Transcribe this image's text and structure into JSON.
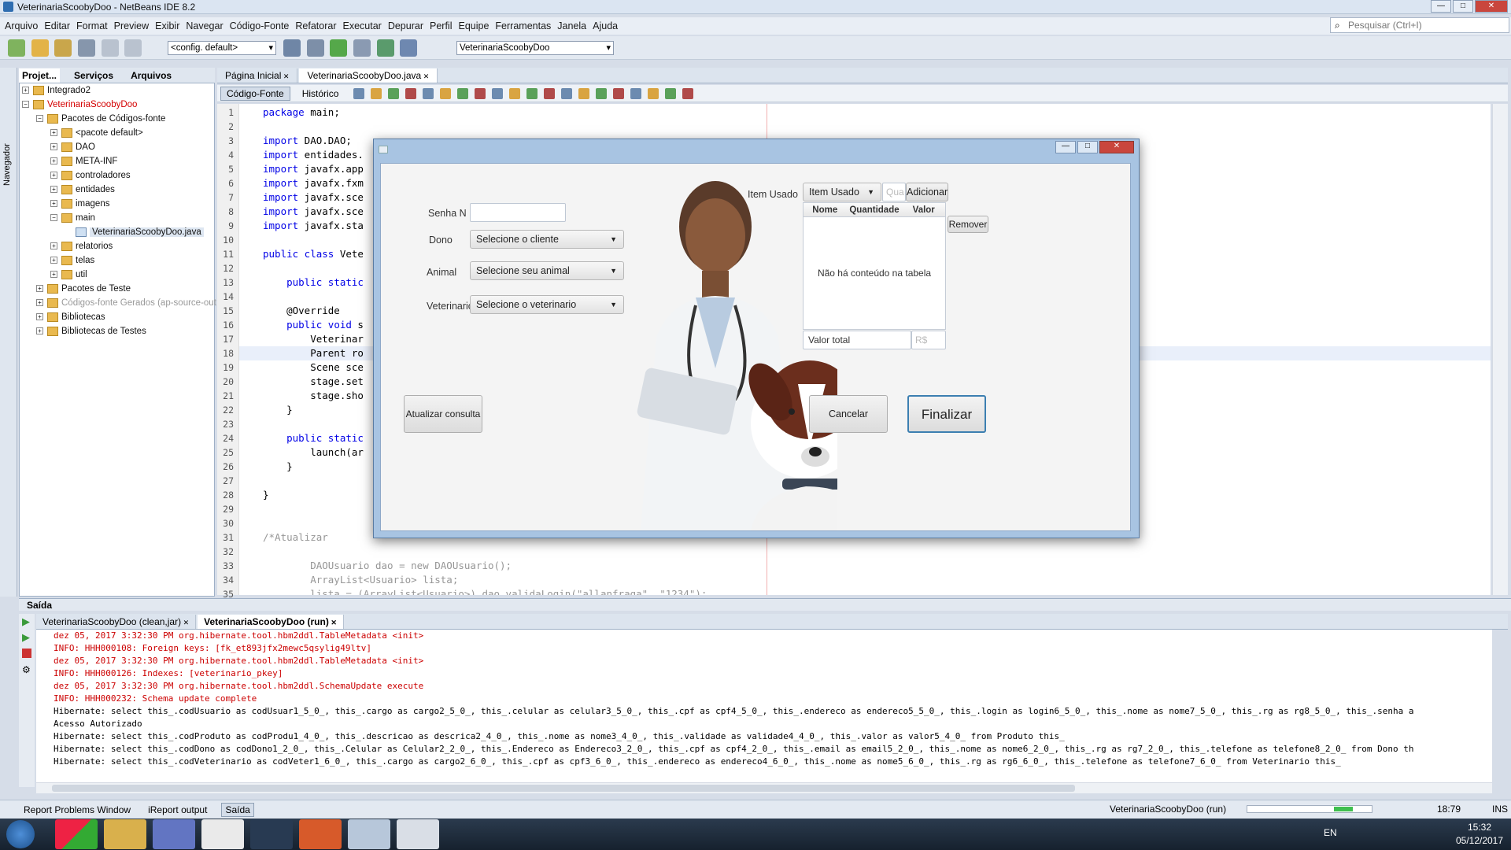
{
  "window": {
    "title": "VeterinariaScoobyDoo - NetBeans IDE 8.2",
    "minimize": "—",
    "maximize": "□",
    "close": "✕"
  },
  "menu": [
    "Arquivo",
    "Editar",
    "Format",
    "Preview",
    "Exibir",
    "Navegar",
    "Código-Fonte",
    "Refatorar",
    "Executar",
    "Depurar",
    "Perfil",
    "Equipe",
    "Ferramentas",
    "Janela",
    "Ajuda"
  ],
  "search": {
    "placeholder": "Pesquisar (Ctrl+I)"
  },
  "toolbar": {
    "config": "<config. default>",
    "project": "VeterinariaScoobyDoo"
  },
  "projects": {
    "tabs": [
      "Projet...",
      "Serviços",
      "Arquivos"
    ],
    "tree": [
      {
        "label": "Integrado2",
        "level": 0,
        "pm": "+"
      },
      {
        "label": "VeterinariaScoobyDoo",
        "level": 0,
        "pm": "−",
        "highlight": true
      },
      {
        "label": "Pacotes de Códigos-fonte",
        "level": 1,
        "pm": "−"
      },
      {
        "label": "<pacote default>",
        "level": 2,
        "pm": "+"
      },
      {
        "label": "DAO",
        "level": 2,
        "pm": "+"
      },
      {
        "label": "META-INF",
        "level": 2,
        "pm": "+"
      },
      {
        "label": "controladores",
        "level": 2,
        "pm": "+"
      },
      {
        "label": "entidades",
        "level": 2,
        "pm": "+"
      },
      {
        "label": "imagens",
        "level": 2,
        "pm": "+"
      },
      {
        "label": "main",
        "level": 2,
        "pm": "−"
      },
      {
        "label": "VeterinariaScoobyDoo.java",
        "level": 3,
        "pm": "",
        "file": true
      },
      {
        "label": "relatorios",
        "level": 2,
        "pm": "+"
      },
      {
        "label": "telas",
        "level": 2,
        "pm": "+"
      },
      {
        "label": "util",
        "level": 2,
        "pm": "+"
      },
      {
        "label": "Pacotes de Teste",
        "level": 1,
        "pm": "+"
      },
      {
        "label": "Códigos-fonte Gerados (ap-source-out",
        "level": 1,
        "pm": "+",
        "dim": true
      },
      {
        "label": "Bibliotecas",
        "level": 1,
        "pm": "+"
      },
      {
        "label": "Bibliotecas de Testes",
        "level": 1,
        "pm": "+"
      }
    ]
  },
  "navigator": "Navegador",
  "editor": {
    "tabs": [
      "Página Inicial",
      "VeterinariaScoobyDoo.java"
    ],
    "subtabs": [
      "Código-Fonte",
      "Histórico"
    ],
    "lines": [
      {
        "n": "1",
        "t": "package main;",
        "k": "package"
      },
      {
        "n": "2",
        "t": ""
      },
      {
        "n": "3",
        "t": "import DAO.DAO;",
        "k": "import"
      },
      {
        "n": "4",
        "t": "import entidades.",
        "k": "import"
      },
      {
        "n": "5",
        "t": "import javafx.app",
        "k": "import"
      },
      {
        "n": "6",
        "t": "import javafx.fxm",
        "k": "import"
      },
      {
        "n": "7",
        "t": "import javafx.sce",
        "k": "import"
      },
      {
        "n": "8",
        "t": "import javafx.sce",
        "k": "import"
      },
      {
        "n": "9",
        "t": "import javafx.sta",
        "k": "import"
      },
      {
        "n": "10",
        "t": ""
      },
      {
        "n": "11",
        "t": "public class Vete",
        "k": "public class"
      },
      {
        "n": "12",
        "t": ""
      },
      {
        "n": "13",
        "t": "    public static",
        "k": "public static"
      },
      {
        "n": "14",
        "t": ""
      },
      {
        "n": "15",
        "t": "    @Override"
      },
      {
        "n": "16",
        "t": "    public void s",
        "k": "public void"
      },
      {
        "n": "17",
        "t": "        Veterinar"
      },
      {
        "n": "18",
        "t": "        Parent ro"
      },
      {
        "n": "19",
        "t": "        Scene sce"
      },
      {
        "n": "20",
        "t": "        stage.set"
      },
      {
        "n": "21",
        "t": "        stage.sho"
      },
      {
        "n": "22",
        "t": "    }"
      },
      {
        "n": "23",
        "t": ""
      },
      {
        "n": "24",
        "t": "    public static",
        "k": "public static"
      },
      {
        "n": "25",
        "t": "        launch(ar"
      },
      {
        "n": "26",
        "t": "    }"
      },
      {
        "n": "27",
        "t": ""
      },
      {
        "n": "28",
        "t": "}"
      },
      {
        "n": "29",
        "t": ""
      },
      {
        "n": "30",
        "t": ""
      },
      {
        "n": "31",
        "t": "/*Atualizar",
        "c": true
      },
      {
        "n": "32",
        "t": "",
        "c": true
      },
      {
        "n": "33",
        "t": "        DAOUsuario dao = new DAOUsuario();",
        "c": true
      },
      {
        "n": "34",
        "t": "        ArrayList<Usuario> lista;",
        "c": true
      },
      {
        "n": "35",
        "t": "        lista = (ArrayList<Usuario>) dao.validaLogin(\"allanfraga\", \"1234\");",
        "c": true
      }
    ]
  },
  "output": {
    "title": "Saída",
    "tabs": [
      "VeterinariaScoobyDoo (clean,jar)",
      "VeterinariaScoobyDoo (run)"
    ],
    "lines": [
      {
        "t": "dez 05, 2017 3:32:30 PM org.hibernate.tool.hbm2ddl.TableMetadata <init>",
        "r": true
      },
      {
        "t": "INFO: HHH000108: Foreign keys: [fk_et893jfx2mewc5qsylig49ltv]",
        "r": true
      },
      {
        "t": "dez 05, 2017 3:32:30 PM org.hibernate.tool.hbm2ddl.TableMetadata <init>",
        "r": true
      },
      {
        "t": "INFO: HHH000126: Indexes: [veterinario_pkey]",
        "r": true
      },
      {
        "t": "dez 05, 2017 3:32:30 PM org.hibernate.tool.hbm2ddl.SchemaUpdate execute",
        "r": true
      },
      {
        "t": "INFO: HHH000232: Schema update complete",
        "r": true
      },
      {
        "t": "Hibernate: select this_.codUsuario as codUsuar1_5_0_, this_.cargo as cargo2_5_0_, this_.celular as celular3_5_0_, this_.cpf as cpf4_5_0_, this_.endereco as endereco5_5_0_, this_.login as login6_5_0_, this_.nome as nome7_5_0_, this_.rg as rg8_5_0_, this_.senha a"
      },
      {
        "t": "Acesso Autorizado"
      },
      {
        "t": "Hibernate: select this_.codProduto as codProdu1_4_0_, this_.descricao as descrica2_4_0_, this_.nome as nome3_4_0_, this_.validade as validade4_4_0_, this_.valor as valor5_4_0_ from Produto this_"
      },
      {
        "t": "Hibernate: select this_.codDono as codDono1_2_0_, this_.Celular as Celular2_2_0_, this_.Endereco as Endereco3_2_0_, this_.cpf as cpf4_2_0_, this_.email as email5_2_0_, this_.nome as nome6_2_0_, this_.rg as rg7_2_0_, this_.telefone as telefone8_2_0_ from Dono th"
      },
      {
        "t": "Hibernate: select this_.codVeterinario as codVeter1_6_0_, this_.cargo as cargo2_6_0_, this_.cpf as cpf3_6_0_, this_.endereco as endereco4_6_0_, this_.nome as nome5_6_0_, this_.rg as rg6_6_0_, this_.telefone as telefone7_6_0_ from Veterinario this_"
      }
    ]
  },
  "statusbar": {
    "tabs": [
      "Report Problems Window",
      "iReport output",
      "Saída"
    ],
    "project": "VeterinariaScoobyDoo (run)",
    "position": "18:79",
    "mode": "INS"
  },
  "taskbar": {
    "lang": "EN",
    "time": "15:32",
    "date": "05/12/2017"
  },
  "dialog": {
    "title": "",
    "senha_label": "Senha N",
    "dono_label": "Dono",
    "dono_value": "Selecione o cliente",
    "animal_label": "Animal",
    "animal_value": "Selecione seu animal",
    "vet_label": "Veterinario",
    "vet_value": "Selecione o veterinario",
    "item_label": "Item Usado",
    "item_value": "Item Usado",
    "qty_placeholder": "Qua",
    "add_button": "Adicionar",
    "remove_button": "Remover",
    "table_headers": [
      "Nome",
      "Quantidade",
      "Valor"
    ],
    "table_empty": "Não há conteúdo na tabela",
    "total_label": "Valor total",
    "total_placeholder": "R$",
    "refresh_button": "Atualizar consulta",
    "cancel_button": "Cancelar",
    "finish_button": "Finalizar",
    "colors": {
      "accent": "#3c7fb1",
      "finish_border": "#3c7fb1"
    }
  }
}
